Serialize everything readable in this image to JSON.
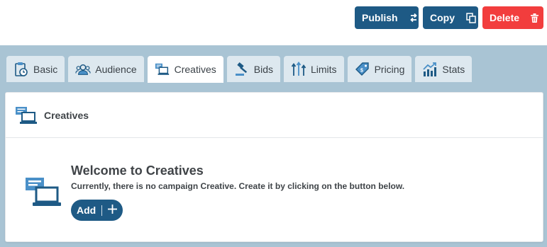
{
  "toolbar": {
    "publish_label": "Publish",
    "copy_label": "Copy",
    "delete_label": "Delete",
    "colors": {
      "primary": "#1e5a85",
      "danger": "#f23d3d"
    }
  },
  "tabs": [
    {
      "label": "Basic",
      "icon": "stopwatch-clipboard-icon",
      "active": false
    },
    {
      "label": "Audience",
      "icon": "audience-group-icon",
      "active": false
    },
    {
      "label": "Creatives",
      "icon": "creatives-monitor-icon",
      "active": true
    },
    {
      "label": "Bids",
      "icon": "gavel-icon",
      "active": false
    },
    {
      "label": "Limits",
      "icon": "limits-arrows-icon",
      "active": false
    },
    {
      "label": "Pricing",
      "icon": "price-tag-icon",
      "active": false
    },
    {
      "label": "Stats",
      "icon": "stats-chart-icon",
      "active": false
    }
  ],
  "panel": {
    "title": "Creatives",
    "welcome_title": "Welcome to Creatives",
    "welcome_desc": "Currently, there is no campaign Creative. Create it by clicking on the button below.",
    "add_label": "Add"
  }
}
